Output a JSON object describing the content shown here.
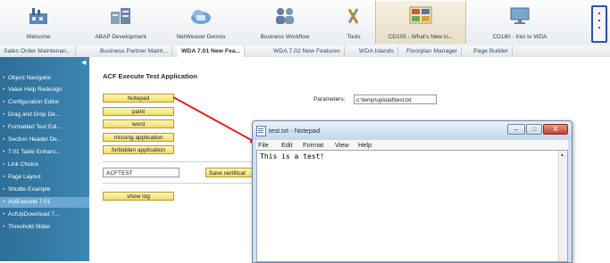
{
  "launchpad": {
    "tiles": [
      {
        "label": "Welcome",
        "icon": "factory-icon"
      },
      {
        "label": "ABAP Development",
        "icon": "buildings-icon"
      },
      {
        "label": "NetWeaver Demos",
        "icon": "cloud-icon"
      },
      {
        "label": "Business Workflow",
        "icon": "people-icon"
      },
      {
        "label": "Tools",
        "icon": "tools-icon"
      },
      {
        "label": "CD105 - What's New in...",
        "icon": "screen-collage-icon"
      },
      {
        "label": "CD160 - Into to WDA",
        "icon": "monitor-icon"
      }
    ],
    "active_index": 5
  },
  "tabs": [
    {
      "label": "Sales Order Maintenan..."
    },
    {
      "label": "Business Partner Maint..."
    },
    {
      "label": "WDA 7.01 New Fea..."
    },
    {
      "label": "WDA 7.02 New Features"
    },
    {
      "label": "WDA Islands"
    },
    {
      "label": "Floorplan Manager"
    },
    {
      "label": "Page Builder"
    }
  ],
  "nav": {
    "items": [
      {
        "label": "Object Navigator"
      },
      {
        "label": "Value Help Redesign"
      },
      {
        "label": "Configuration Editor"
      },
      {
        "label": "Drag and Drop De..."
      },
      {
        "label": "Formatted Text Edi..."
      },
      {
        "label": "Section Header De..."
      },
      {
        "label": "7.01 Table Enhanc..."
      },
      {
        "label": "Link Choice"
      },
      {
        "label": "Page Layout"
      },
      {
        "label": "Shuttle Example"
      },
      {
        "label": "AcfExecute 7.01"
      },
      {
        "label": "AcfUpDownload 7..."
      },
      {
        "label": "Threshold Slider"
      }
    ],
    "selected_index": 10
  },
  "app": {
    "title": "ACF Execute Test Application",
    "buttons": {
      "notepad": "Notepad",
      "paint": "paint",
      "word": "word",
      "missing": "missing application",
      "forbidden": "forbidden application",
      "show_log": "show log"
    },
    "params_label": "Parameters:",
    "params_value": "c:\\temp\\upload\\test.txt",
    "cert_value": "ACFTEST",
    "cert_button": "Save certificat"
  },
  "notepad": {
    "title": "test.txt - Notepad",
    "menu": [
      "File",
      "Edit",
      "Format",
      "View",
      "Help"
    ],
    "content": "This is a test!",
    "controls": {
      "minimize": "–",
      "maximize": "□",
      "close": "X"
    }
  },
  "colors": {
    "nav_bg": "#3c86b2",
    "button_yellow": "#f2dc6a",
    "arrow_red": "#e02020",
    "highlight_box": "#2d4ea8"
  }
}
